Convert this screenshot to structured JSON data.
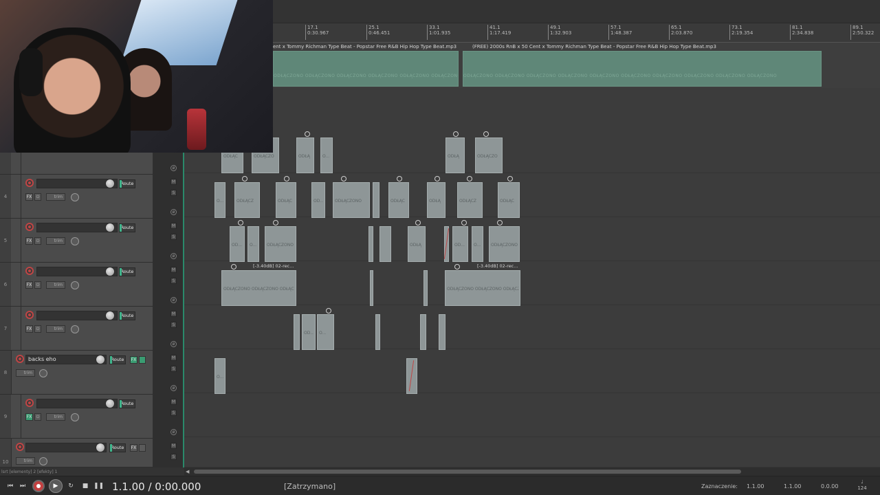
{
  "ruler": {
    "ticks": [
      {
        "bar": "17.1",
        "time": "0:30.967"
      },
      {
        "bar": "25.1",
        "time": "0:46.451"
      },
      {
        "bar": "33.1",
        "time": "1:01.935"
      },
      {
        "bar": "41.1",
        "time": "1:17.419"
      },
      {
        "bar": "49.1",
        "time": "1:32.903"
      },
      {
        "bar": "57.1",
        "time": "1:48.387"
      },
      {
        "bar": "65.1",
        "time": "2:03.870"
      },
      {
        "bar": "73.1",
        "time": "2:19.354"
      },
      {
        "bar": "81.1",
        "time": "2:34.838"
      },
      {
        "bar": "89.1",
        "time": "2:50.322"
      }
    ]
  },
  "top_track": {
    "item1_name": "ent x Tommy Richman Type Beat - Popstar  Free R&B Hip Hop Type Beat.mp3",
    "item2_name": "(FREE) 2000s RnB x 50 Cent x Tommy Richman Type Beat - Popstar  Free R&B Hip Hop Type Beat.mp3",
    "offline_label": "ODŁĄCZONO   ODŁĄCZONO   ODŁĄCZONO   ODŁĄCZONO   ODŁĄCZONO   ODŁĄCZONO   ODŁĄCZONO   ODŁĄCZONO   ODŁĄCZONO   ODŁĄCZONO"
  },
  "tracks": {
    "t4": {
      "num": "4",
      "route": "Route",
      "fx": "FX",
      "trim": "trim"
    },
    "t5": {
      "num": "5",
      "route": "Route",
      "fx": "FX",
      "trim": "trim"
    },
    "t6": {
      "num": "6",
      "route": "Route",
      "fx": "FX",
      "trim": "trim"
    },
    "t7": {
      "num": "7",
      "route": "Route",
      "fx": "FX",
      "trim": "trim"
    },
    "t8": {
      "num": "8",
      "name": "backs eho",
      "route": "Route",
      "fx": "FX",
      "trim": "trim"
    },
    "t9": {
      "num": "9",
      "route": "Route",
      "fx": "FX",
      "trim": "trim"
    },
    "t10": {
      "num": "10",
      "route": "Route",
      "fx": "FX",
      "trim": "trim"
    }
  },
  "items": {
    "odlaczono": "ODŁĄCZONO",
    "odlac": "ODŁĄC",
    "odlacz": "ODŁĄCZ",
    "odlacz2": "ODŁĄCZO",
    "odla": "ODŁĄ",
    "o": "O...",
    "od": "OD...",
    "odl": "OD...",
    "hdr_db_left": "[-3.40dB] 02-rec...",
    "hdr_db_right": "[-3.40dB] 02-rec..."
  },
  "ms": {
    "m": "M",
    "s": "S"
  },
  "status_left": "lsrt [elementy] 2 [efekty] 1",
  "transport": {
    "timecode": "1.1.00 / 0:00.000",
    "state": "[Zatrzymano]",
    "selection_label": "Zaznaczenie:",
    "sel_start": "1.1.00",
    "sel_end": "1.1.00",
    "sel_len": "0.0.00",
    "bpm": "124"
  }
}
